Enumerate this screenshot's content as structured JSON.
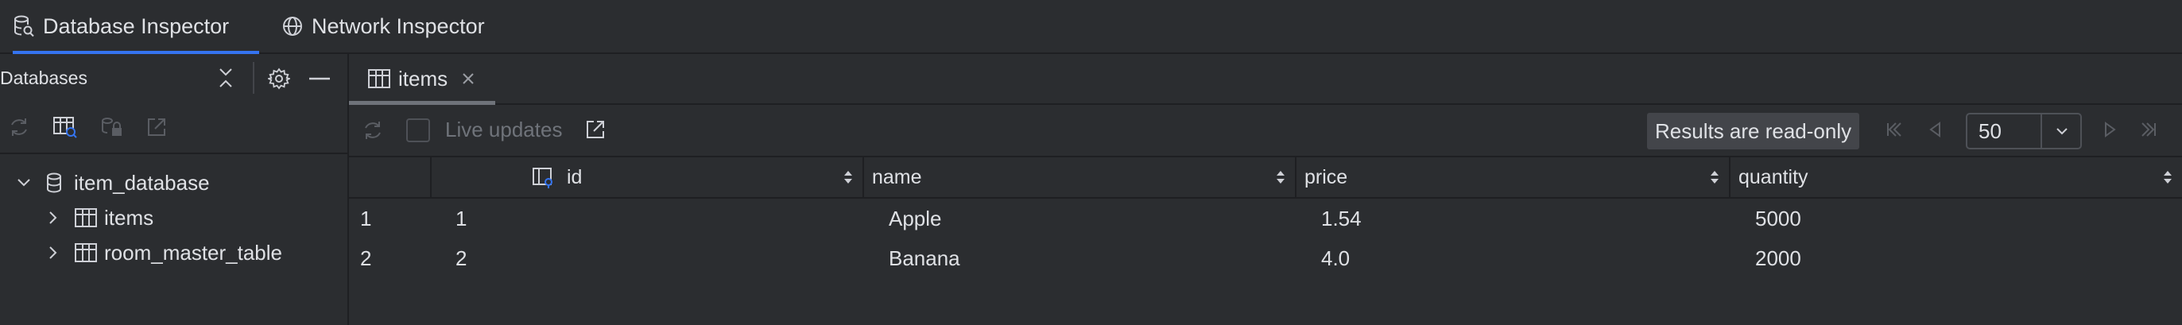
{
  "top_tabs": [
    {
      "label": "Database Inspector",
      "icon": "database-search-icon",
      "active": true
    },
    {
      "label": "Network Inspector",
      "icon": "globe-icon",
      "active": false
    }
  ],
  "left_panel": {
    "title": "Databases",
    "tree": {
      "database": {
        "label": "item_database",
        "icon": "database-icon",
        "expanded": true
      },
      "tables": [
        {
          "label": "items",
          "icon": "table-icon",
          "expanded": false
        },
        {
          "label": "room_master_table",
          "icon": "table-icon",
          "expanded": false
        }
      ]
    }
  },
  "editor": {
    "tab": {
      "label": "items",
      "icon": "table-icon"
    },
    "toolbar": {
      "live_updates_label": "Live updates",
      "live_updates_checked": false,
      "read_only_badge": "Results are read-only",
      "page_size": "50"
    },
    "table": {
      "columns": [
        "id",
        "name",
        "price",
        "quantity"
      ],
      "rows": [
        {
          "row_num": "1",
          "id": "1",
          "name": "Apple",
          "price": "1.54",
          "quantity": "5000"
        },
        {
          "row_num": "2",
          "id": "2",
          "name": "Banana",
          "price": "4.0",
          "quantity": "2000"
        }
      ]
    }
  },
  "colors": {
    "background": "#2b2d30",
    "accent": "#3574f0",
    "border": "#1e1f22",
    "text": "#dfe1e5",
    "disabled": "#6f737a"
  }
}
